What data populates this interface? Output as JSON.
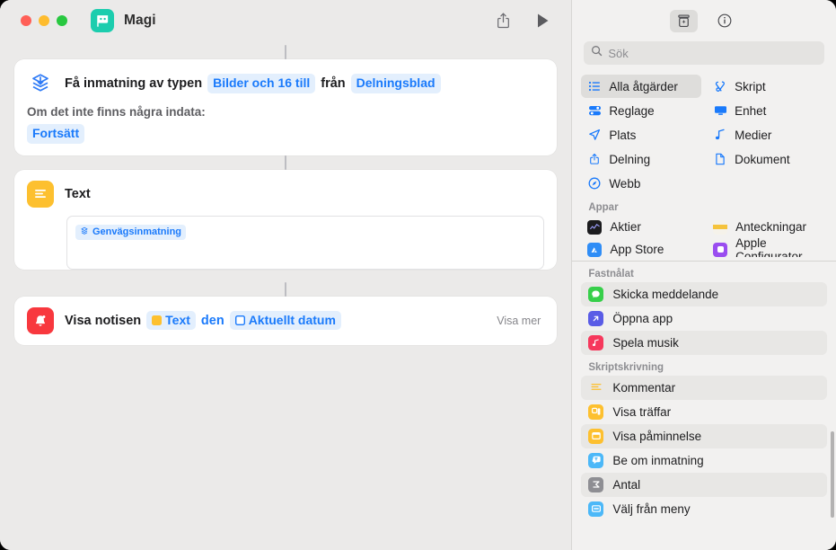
{
  "window": {
    "title": "Magi",
    "traffic_lights": [
      "close",
      "minimize",
      "zoom"
    ],
    "toolbar": {
      "share_label": "Dela",
      "play_label": "Kör"
    }
  },
  "editor": {
    "actions": [
      {
        "icon": "shortcut-input-icon",
        "icon_color": "#2f7bf6",
        "phrase": [
          {
            "type": "text",
            "value": "Få inmatning av typen"
          },
          {
            "type": "token",
            "value": "Bilder och 16 till"
          },
          {
            "type": "text",
            "value": "från"
          },
          {
            "type": "token",
            "value": "Delningsblad"
          }
        ],
        "sub_label": "Om det inte finns några indata:",
        "sub_token": "Fortsätt"
      },
      {
        "icon": "text-icon",
        "icon_color": "#fdc02f",
        "title": "Text",
        "field_token": "Genvägsinmatning",
        "field_token_icon": "shortcut-input-icon"
      },
      {
        "icon": "notification-bell-icon",
        "icon_color": "#f8383e",
        "phrase": [
          {
            "type": "text",
            "value": "Visa notisen"
          },
          {
            "type": "token",
            "value": "Text",
            "glyph_color": "#fdc02f"
          },
          {
            "type": "text",
            "value": "den"
          },
          {
            "type": "token",
            "value": "Aktuellt datum",
            "glyph_color": "#1a7afb"
          }
        ],
        "show_more": "Visa mer"
      }
    ]
  },
  "library": {
    "toolbar": {
      "add_action_label": "Åtgärdsbibliotek",
      "info_label": "Info"
    },
    "search": {
      "placeholder": "Sök",
      "value": ""
    },
    "categories": [
      {
        "label": "Alla åtgärder",
        "icon": "list-icon",
        "selected": true
      },
      {
        "label": "Skript",
        "icon": "script-icon",
        "selected": false
      },
      {
        "label": "Reglage",
        "icon": "controls-icon",
        "selected": false
      },
      {
        "label": "Enhet",
        "icon": "device-icon",
        "selected": false
      },
      {
        "label": "Plats",
        "icon": "location-icon",
        "selected": false
      },
      {
        "label": "Medier",
        "icon": "media-note-icon",
        "selected": false
      },
      {
        "label": "Delning",
        "icon": "share-icon",
        "selected": false
      },
      {
        "label": "Dokument",
        "icon": "document-icon",
        "selected": false
      },
      {
        "label": "Webb",
        "icon": "web-compass-icon",
        "selected": false
      }
    ],
    "sections": [
      {
        "title": "Appar",
        "apps": [
          {
            "label": "Aktier",
            "icon": "stocks-app-icon",
            "color": "#1c1c1e"
          },
          {
            "label": "Anteckningar",
            "icon": "notes-app-icon",
            "color": "#f5c33b"
          },
          {
            "label": "App Store",
            "icon": "app-store-icon",
            "color": "#2f8df6"
          },
          {
            "label": "Apple Configurator",
            "icon": "apple-configurator-icon",
            "color": "#9a4df0"
          }
        ]
      },
      {
        "title": "Fastnålat",
        "items": [
          {
            "label": "Skicka meddelande",
            "icon": "messages-icon",
            "color": "#37cf4a"
          },
          {
            "label": "Öppna app",
            "icon": "open-app-icon",
            "color": "#5a5ce6"
          },
          {
            "label": "Spela musik",
            "icon": "music-icon",
            "color": "#f6385c"
          }
        ]
      },
      {
        "title": "Skriptskrivning",
        "items": [
          {
            "label": "Kommentar",
            "icon": "comment-icon",
            "color": "#fdc02f"
          },
          {
            "label": "Visa träffar",
            "icon": "show-result-icon",
            "color": "#fdc02f"
          },
          {
            "label": "Visa påminnelse",
            "icon": "show-alert-icon",
            "color": "#fdc02f"
          },
          {
            "label": "Be om inmatning",
            "icon": "ask-for-input-icon",
            "color": "#4cb8f8"
          },
          {
            "label": "Antal",
            "icon": "count-icon",
            "color": "#8e8e93"
          },
          {
            "label": "Välj från meny",
            "icon": "choose-from-menu-icon",
            "color": "#4cb8f8"
          }
        ]
      }
    ]
  },
  "colors": {
    "accent_blue": "#1a7afb",
    "token_bg": "#e3effd",
    "canvas_bg": "#ebeae9",
    "panel_bg": "#f2f1f0"
  }
}
